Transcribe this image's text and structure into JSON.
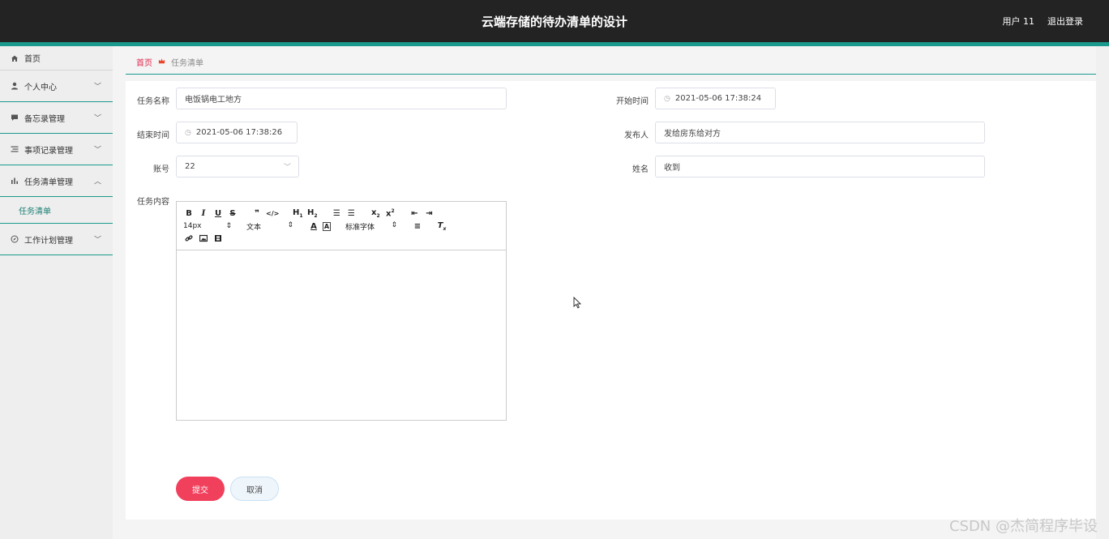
{
  "header": {
    "title": "云端存储的待办清单的设计",
    "user": "用户 11",
    "logout": "退出登录"
  },
  "sidebar": {
    "items": [
      {
        "label": "首页",
        "icon": "home-icon"
      },
      {
        "label": "个人中心",
        "icon": "user-icon"
      },
      {
        "label": "备忘录管理",
        "icon": "comment-icon"
      },
      {
        "label": "事项记录管理",
        "icon": "list-icon"
      },
      {
        "label": "任务清单管理",
        "icon": "bar-chart-icon"
      },
      {
        "label": "工作计划管理",
        "icon": "compass-icon"
      }
    ],
    "submenu": "任务清单"
  },
  "breadcrumb": {
    "home": "首页",
    "current": "任务清单"
  },
  "form": {
    "task_name_label": "任务名称",
    "task_name_value": "电饭锅电工地方",
    "start_time_label": "开始时间",
    "start_time_value": "2021-05-06 17:38:24",
    "end_time_label": "结束时间",
    "end_time_value": "2021-05-06 17:38:26",
    "publisher_label": "发布人",
    "publisher_value": "发给房东给对方",
    "account_label": "账号",
    "account_value": "22",
    "name_label": "姓名",
    "name_value": "收到",
    "content_label": "任务内容"
  },
  "editor": {
    "size_select": "14px",
    "text_select": "文本",
    "font_select": "标准字体"
  },
  "buttons": {
    "submit": "提交",
    "cancel": "取消"
  },
  "watermark": "CSDN @杰简程序毕设"
}
